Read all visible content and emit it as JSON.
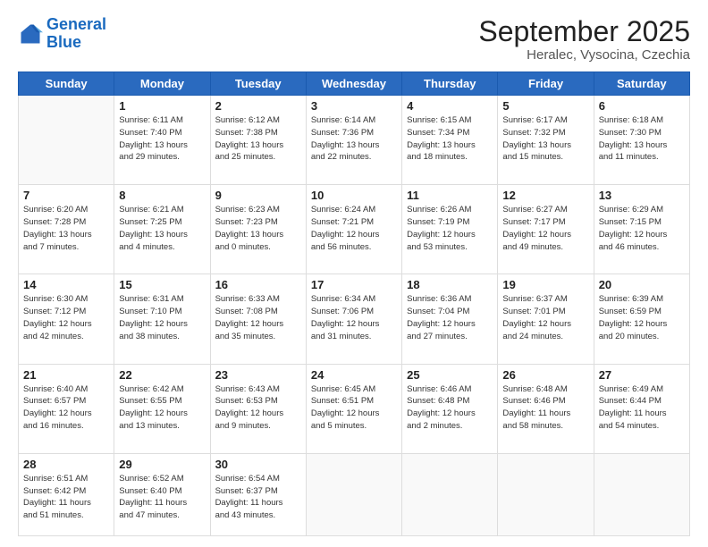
{
  "logo": {
    "line1": "General",
    "line2": "Blue"
  },
  "header": {
    "month": "September 2025",
    "location": "Heralec, Vysocina, Czechia"
  },
  "weekdays": [
    "Sunday",
    "Monday",
    "Tuesday",
    "Wednesday",
    "Thursday",
    "Friday",
    "Saturday"
  ],
  "weeks": [
    [
      {
        "day": "",
        "detail": ""
      },
      {
        "day": "1",
        "detail": "Sunrise: 6:11 AM\nSunset: 7:40 PM\nDaylight: 13 hours\nand 29 minutes."
      },
      {
        "day": "2",
        "detail": "Sunrise: 6:12 AM\nSunset: 7:38 PM\nDaylight: 13 hours\nand 25 minutes."
      },
      {
        "day": "3",
        "detail": "Sunrise: 6:14 AM\nSunset: 7:36 PM\nDaylight: 13 hours\nand 22 minutes."
      },
      {
        "day": "4",
        "detail": "Sunrise: 6:15 AM\nSunset: 7:34 PM\nDaylight: 13 hours\nand 18 minutes."
      },
      {
        "day": "5",
        "detail": "Sunrise: 6:17 AM\nSunset: 7:32 PM\nDaylight: 13 hours\nand 15 minutes."
      },
      {
        "day": "6",
        "detail": "Sunrise: 6:18 AM\nSunset: 7:30 PM\nDaylight: 13 hours\nand 11 minutes."
      }
    ],
    [
      {
        "day": "7",
        "detail": "Sunrise: 6:20 AM\nSunset: 7:28 PM\nDaylight: 13 hours\nand 7 minutes."
      },
      {
        "day": "8",
        "detail": "Sunrise: 6:21 AM\nSunset: 7:25 PM\nDaylight: 13 hours\nand 4 minutes."
      },
      {
        "day": "9",
        "detail": "Sunrise: 6:23 AM\nSunset: 7:23 PM\nDaylight: 13 hours\nand 0 minutes."
      },
      {
        "day": "10",
        "detail": "Sunrise: 6:24 AM\nSunset: 7:21 PM\nDaylight: 12 hours\nand 56 minutes."
      },
      {
        "day": "11",
        "detail": "Sunrise: 6:26 AM\nSunset: 7:19 PM\nDaylight: 12 hours\nand 53 minutes."
      },
      {
        "day": "12",
        "detail": "Sunrise: 6:27 AM\nSunset: 7:17 PM\nDaylight: 12 hours\nand 49 minutes."
      },
      {
        "day": "13",
        "detail": "Sunrise: 6:29 AM\nSunset: 7:15 PM\nDaylight: 12 hours\nand 46 minutes."
      }
    ],
    [
      {
        "day": "14",
        "detail": "Sunrise: 6:30 AM\nSunset: 7:12 PM\nDaylight: 12 hours\nand 42 minutes."
      },
      {
        "day": "15",
        "detail": "Sunrise: 6:31 AM\nSunset: 7:10 PM\nDaylight: 12 hours\nand 38 minutes."
      },
      {
        "day": "16",
        "detail": "Sunrise: 6:33 AM\nSunset: 7:08 PM\nDaylight: 12 hours\nand 35 minutes."
      },
      {
        "day": "17",
        "detail": "Sunrise: 6:34 AM\nSunset: 7:06 PM\nDaylight: 12 hours\nand 31 minutes."
      },
      {
        "day": "18",
        "detail": "Sunrise: 6:36 AM\nSunset: 7:04 PM\nDaylight: 12 hours\nand 27 minutes."
      },
      {
        "day": "19",
        "detail": "Sunrise: 6:37 AM\nSunset: 7:01 PM\nDaylight: 12 hours\nand 24 minutes."
      },
      {
        "day": "20",
        "detail": "Sunrise: 6:39 AM\nSunset: 6:59 PM\nDaylight: 12 hours\nand 20 minutes."
      }
    ],
    [
      {
        "day": "21",
        "detail": "Sunrise: 6:40 AM\nSunset: 6:57 PM\nDaylight: 12 hours\nand 16 minutes."
      },
      {
        "day": "22",
        "detail": "Sunrise: 6:42 AM\nSunset: 6:55 PM\nDaylight: 12 hours\nand 13 minutes."
      },
      {
        "day": "23",
        "detail": "Sunrise: 6:43 AM\nSunset: 6:53 PM\nDaylight: 12 hours\nand 9 minutes."
      },
      {
        "day": "24",
        "detail": "Sunrise: 6:45 AM\nSunset: 6:51 PM\nDaylight: 12 hours\nand 5 minutes."
      },
      {
        "day": "25",
        "detail": "Sunrise: 6:46 AM\nSunset: 6:48 PM\nDaylight: 12 hours\nand 2 minutes."
      },
      {
        "day": "26",
        "detail": "Sunrise: 6:48 AM\nSunset: 6:46 PM\nDaylight: 11 hours\nand 58 minutes."
      },
      {
        "day": "27",
        "detail": "Sunrise: 6:49 AM\nSunset: 6:44 PM\nDaylight: 11 hours\nand 54 minutes."
      }
    ],
    [
      {
        "day": "28",
        "detail": "Sunrise: 6:51 AM\nSunset: 6:42 PM\nDaylight: 11 hours\nand 51 minutes."
      },
      {
        "day": "29",
        "detail": "Sunrise: 6:52 AM\nSunset: 6:40 PM\nDaylight: 11 hours\nand 47 minutes."
      },
      {
        "day": "30",
        "detail": "Sunrise: 6:54 AM\nSunset: 6:37 PM\nDaylight: 11 hours\nand 43 minutes."
      },
      {
        "day": "",
        "detail": ""
      },
      {
        "day": "",
        "detail": ""
      },
      {
        "day": "",
        "detail": ""
      },
      {
        "day": "",
        "detail": ""
      }
    ]
  ]
}
